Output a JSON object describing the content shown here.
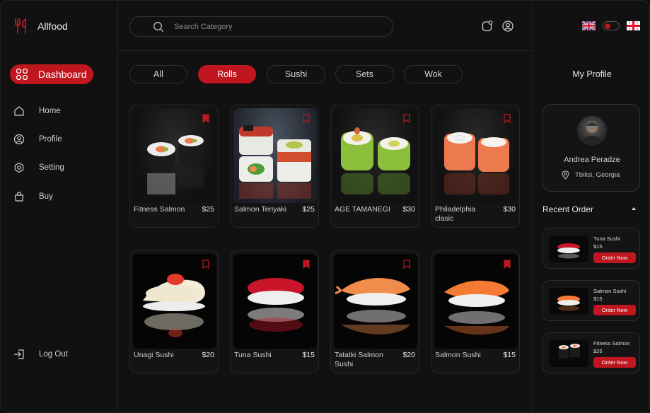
{
  "app": {
    "name": "Allfood",
    "accent": "#c0161f"
  },
  "sidebar": {
    "dashboard_label": "Dashboard",
    "items": [
      {
        "label": "Home",
        "icon": "home-icon"
      },
      {
        "label": "Profile",
        "icon": "user-icon"
      },
      {
        "label": "Setting",
        "icon": "settings-icon"
      },
      {
        "label": "Buy",
        "icon": "bag-icon"
      }
    ],
    "logout_label": "Log Out"
  },
  "header": {
    "search_placeholder": "Search Category",
    "icons": [
      "notification-icon",
      "account-icon"
    ]
  },
  "tabs": [
    {
      "label": "All",
      "active": false
    },
    {
      "label": "Rolls",
      "active": true
    },
    {
      "label": "Sushi",
      "active": false
    },
    {
      "label": "Sets",
      "active": false
    },
    {
      "label": "Wok",
      "active": false
    }
  ],
  "products": [
    {
      "name": "Fitness Salmon",
      "price": "$25",
      "bookmarked": true
    },
    {
      "name": "Salmon Teriyaki",
      "price": "$25",
      "bookmarked": false
    },
    {
      "name": "AGE TAMANEGI",
      "price": "$30",
      "bookmarked": false
    },
    {
      "name": "Philadelphia clasic",
      "price": "$30",
      "bookmarked": false
    },
    {
      "name": "Unagi Sushi",
      "price": "$20",
      "bookmarked": false
    },
    {
      "name": "Tuna Sushi",
      "price": "$15",
      "bookmarked": true
    },
    {
      "name": "Tatatki Salmon Sushi",
      "price": "$20",
      "bookmarked": false
    },
    {
      "name": "Salmon Sushi",
      "price": "$15",
      "bookmarked": true
    }
  ],
  "right_panel": {
    "flags": [
      "uk-flag-icon",
      "georgia-flag-icon"
    ],
    "theme_toggle_on": true,
    "title": "My Profile",
    "profile": {
      "name": "Andrea Peradze",
      "location": "Tbilisi, Georgia"
    },
    "recent_title": "Recent Order",
    "orders": [
      {
        "name": "Tuna Sushi",
        "price": "$15",
        "button": "Order Now"
      },
      {
        "name": "Salmon Sushi",
        "price": "$15",
        "button": "Order Now"
      },
      {
        "name": "Fitness Salmon",
        "price": "$25",
        "button": "Order Now"
      }
    ]
  }
}
